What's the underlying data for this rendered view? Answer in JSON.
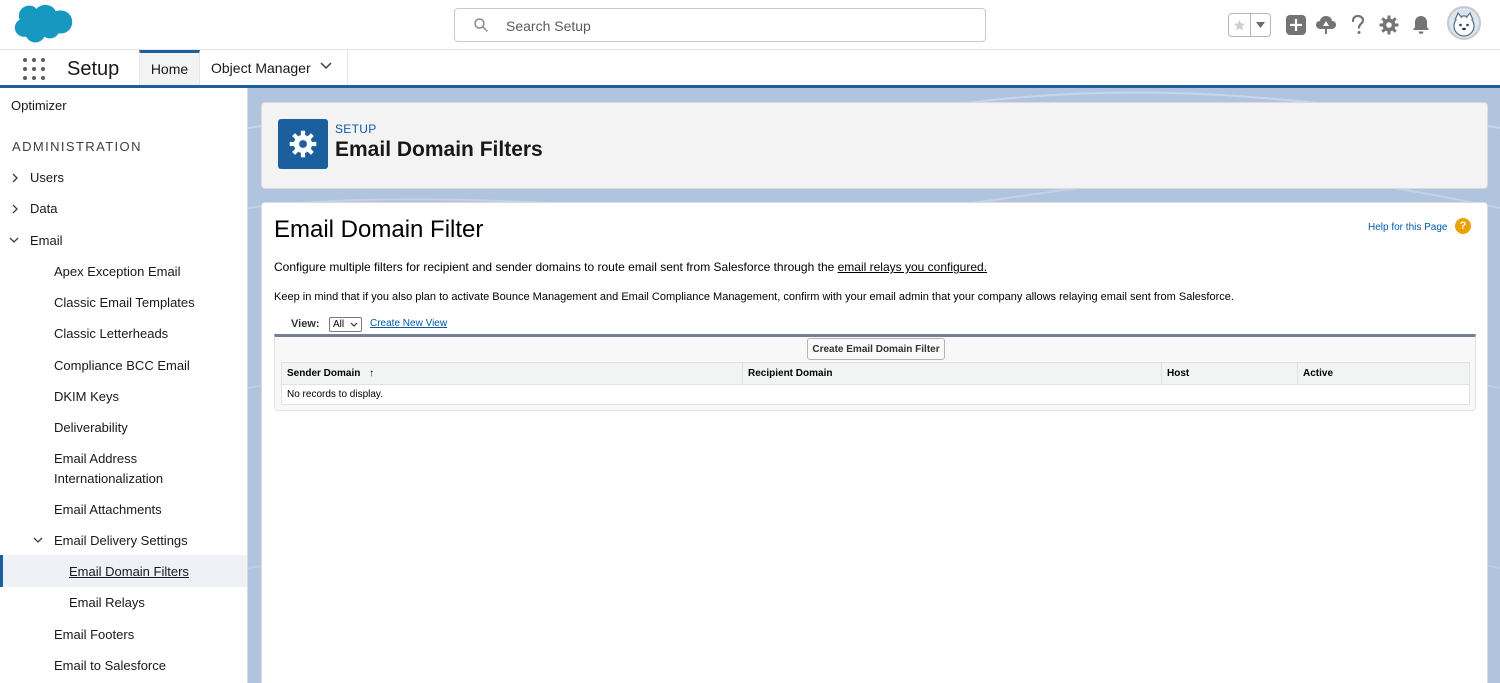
{
  "header": {
    "logo_icon": "salesforce-cloud-logo",
    "search_placeholder": "Search Setup",
    "icons": [
      "star-icon",
      "add-icon",
      "trailhead-icon",
      "help-icon",
      "gear-icon",
      "bell-icon",
      "avatar"
    ]
  },
  "nav": {
    "app_name": "Setup",
    "tabs": [
      {
        "label": "Home"
      },
      {
        "label": "Object Manager"
      }
    ]
  },
  "sidebar": {
    "top_item": "Optimizer",
    "section": "ADMINISTRATION",
    "items": [
      {
        "label": "Users"
      },
      {
        "label": "Data"
      },
      {
        "label": "Email"
      },
      {
        "label": "Apex Exception Email"
      },
      {
        "label": "Classic Email Templates"
      },
      {
        "label": "Classic Letterheads"
      },
      {
        "label": "Compliance BCC Email"
      },
      {
        "label": "DKIM Keys"
      },
      {
        "label": "Deliverability"
      },
      {
        "label": "Email Address"
      },
      {
        "label": "Internationalization"
      },
      {
        "label": "Email Attachments"
      },
      {
        "label": "Email Delivery Settings"
      },
      {
        "label": "Email Domain Filters"
      },
      {
        "label": "Email Relays"
      },
      {
        "label": "Email Footers"
      },
      {
        "label": "Email to Salesforce"
      }
    ]
  },
  "page_header": {
    "eyebrow": "SETUP",
    "title": "Email Domain Filters"
  },
  "content": {
    "heading": "Email Domain Filter",
    "help_link": "Help for this Page",
    "description_prefix": "Configure multiple filters for recipient and sender domains to route email sent from Salesforce through the ",
    "description_link": "email relays you configured.",
    "note": "Keep in mind that if you also plan to activate Bounce Management and Email Compliance Management, confirm with your email admin that your company allows relaying email sent from Salesforce.",
    "view_label": "View:",
    "view_selected": "All",
    "create_new_view": "Create New View",
    "create_button": "Create Email Domain Filter",
    "columns": [
      "Sender Domain",
      "Recipient Domain",
      "Host",
      "Active"
    ],
    "sort_indicator": "↑",
    "empty_message": "No records to display."
  },
  "colors": {
    "brand_blue": "#1b5f9e",
    "link_blue": "#015ba7",
    "background": "#b0c4df"
  }
}
